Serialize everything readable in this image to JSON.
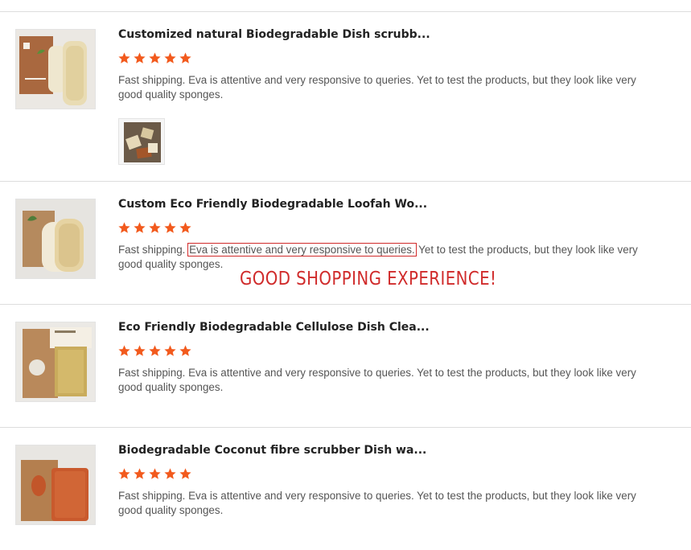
{
  "reviews": [
    {
      "title": "Customized natural Biodegradable Dish scrubb...",
      "rating": 5,
      "text_before": "Fast shipping. Eva is attentive and very responsive to queries. Yet to test the products, but they look like very good quality sponges.",
      "has_photo": true
    },
    {
      "title": "Custom Eco Friendly Biodegradable Loofah Wo...",
      "rating": 5,
      "text_before": "Fast shipping. ",
      "text_highlight": "Eva is attentive and very responsive to queries.",
      "text_after": " Yet to test the products, but they look like very good quality sponges."
    },
    {
      "title": "Eco Friendly Biodegradable Cellulose Dish Clea...",
      "rating": 5,
      "text_before": "Fast shipping. Eva is attentive and very responsive to queries. Yet to test the products, but they look like very good quality sponges."
    },
    {
      "title": "Biodegradable Coconut fibre scrubber Dish wa...",
      "rating": 5,
      "text_before": "Fast shipping. Eva is attentive and very responsive to queries. Yet to test the products, but they look like very good quality sponges."
    }
  ],
  "annotation": "GOOD SHOPPING EXPERIENCE!",
  "colors": {
    "star": "#f25a1d",
    "highlight_box": "#d12a2a",
    "annotation": "#d02b2b"
  },
  "icons": {
    "star": "star-icon"
  }
}
